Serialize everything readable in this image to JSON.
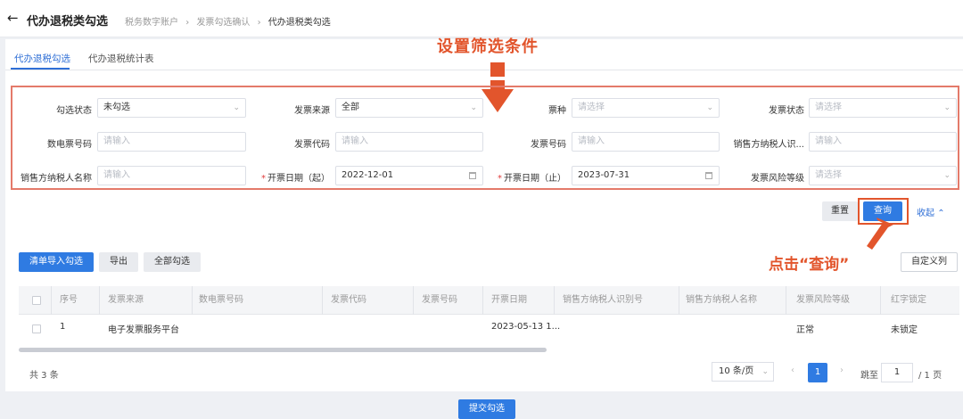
{
  "header": {
    "back_icon": "arrow-left-icon",
    "title": "代办退税类勾选",
    "breadcrumbs": [
      "税务数字账户",
      "发票勾选确认",
      "代办退税类勾选"
    ],
    "separator": "›"
  },
  "tabs": [
    {
      "label": "代办退税勾选",
      "active": true
    },
    {
      "label": "代办退税统计表",
      "active": false
    }
  ],
  "annotations": {
    "set_filter": "设置筛选条件",
    "click_query": "点击“查询”",
    "highlight_color": "#e2552c"
  },
  "filters": {
    "check_status": {
      "label": "勾选状态",
      "value": "未勾选"
    },
    "invoice_source": {
      "label": "发票来源",
      "value": "全部"
    },
    "ticket_type": {
      "label": "票种",
      "placeholder": "请选择"
    },
    "invoice_status": {
      "label": "发票状态",
      "placeholder": "请选择"
    },
    "digital_no": {
      "label": "数电票号码",
      "placeholder": "请输入"
    },
    "invoice_code": {
      "label": "发票代码",
      "placeholder": "请输入"
    },
    "invoice_no": {
      "label": "发票号码",
      "placeholder": "请输入"
    },
    "seller_tax_id": {
      "label": "销售方纳税人识...",
      "placeholder": "请输入"
    },
    "seller_name": {
      "label": "销售方纳税人名称",
      "placeholder": "请输入"
    },
    "date_start": {
      "required": "*",
      "label": "开票日期（起）",
      "value": "2022-12-01"
    },
    "date_end": {
      "required": "*",
      "label": "开票日期（止）",
      "value": "2023-07-31"
    },
    "risk_level": {
      "label": "发票风险等级",
      "placeholder": "请选择"
    }
  },
  "actions": {
    "reset": "重置",
    "query": "查询",
    "collapse": "收起",
    "collapse_icon": "chevron-up-icon"
  },
  "table_actions": {
    "import_check": "清单导入勾选",
    "export": "导出",
    "select_all": "全部勾选",
    "custom_columns": "自定义列"
  },
  "table": {
    "columns": [
      "序号",
      "发票来源",
      "数电票号码",
      "发票代码",
      "发票号码",
      "开票日期",
      "销售方纳税人识别号",
      "销售方纳税人名称",
      "发票风险等级",
      "红字锁定"
    ],
    "rows": [
      {
        "index": "1",
        "source": "电子发票服务平台",
        "digital_no": "",
        "code": "",
        "number": "",
        "date": "2023-05-13 1...",
        "seller_id": "",
        "seller_name": "",
        "risk": "正常",
        "red_lock": "未锁定"
      }
    ]
  },
  "pagination": {
    "total": "共 3 条",
    "page_size": "10 条/页",
    "current_page": "1",
    "prev": "‹",
    "next": "›",
    "jump_prefix": "跳至",
    "jump_value": "1",
    "jump_suffix": "/ 1 页"
  },
  "footer": {
    "submit": "提交勾选"
  }
}
